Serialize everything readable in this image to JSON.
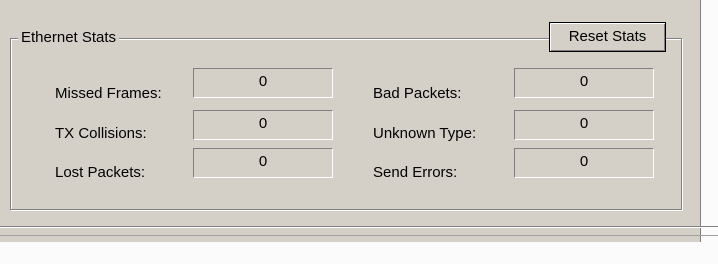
{
  "group": {
    "title": "Ethernet Stats",
    "reset_button_label": "Reset Stats"
  },
  "left_stats": [
    {
      "label": "Missed Frames:",
      "value": "0"
    },
    {
      "label": "TX Collisions:",
      "value": "0"
    },
    {
      "label": "Lost Packets:",
      "value": "0"
    }
  ],
  "right_stats": [
    {
      "label": "Bad Packets:",
      "value": "0"
    },
    {
      "label": "Unknown Type:",
      "value": "0"
    },
    {
      "label": "Send Errors:",
      "value": "0"
    }
  ],
  "colors": {
    "dialog_face": "#d4d0c8",
    "shadow": "#808080",
    "highlight": "#ffffff"
  }
}
